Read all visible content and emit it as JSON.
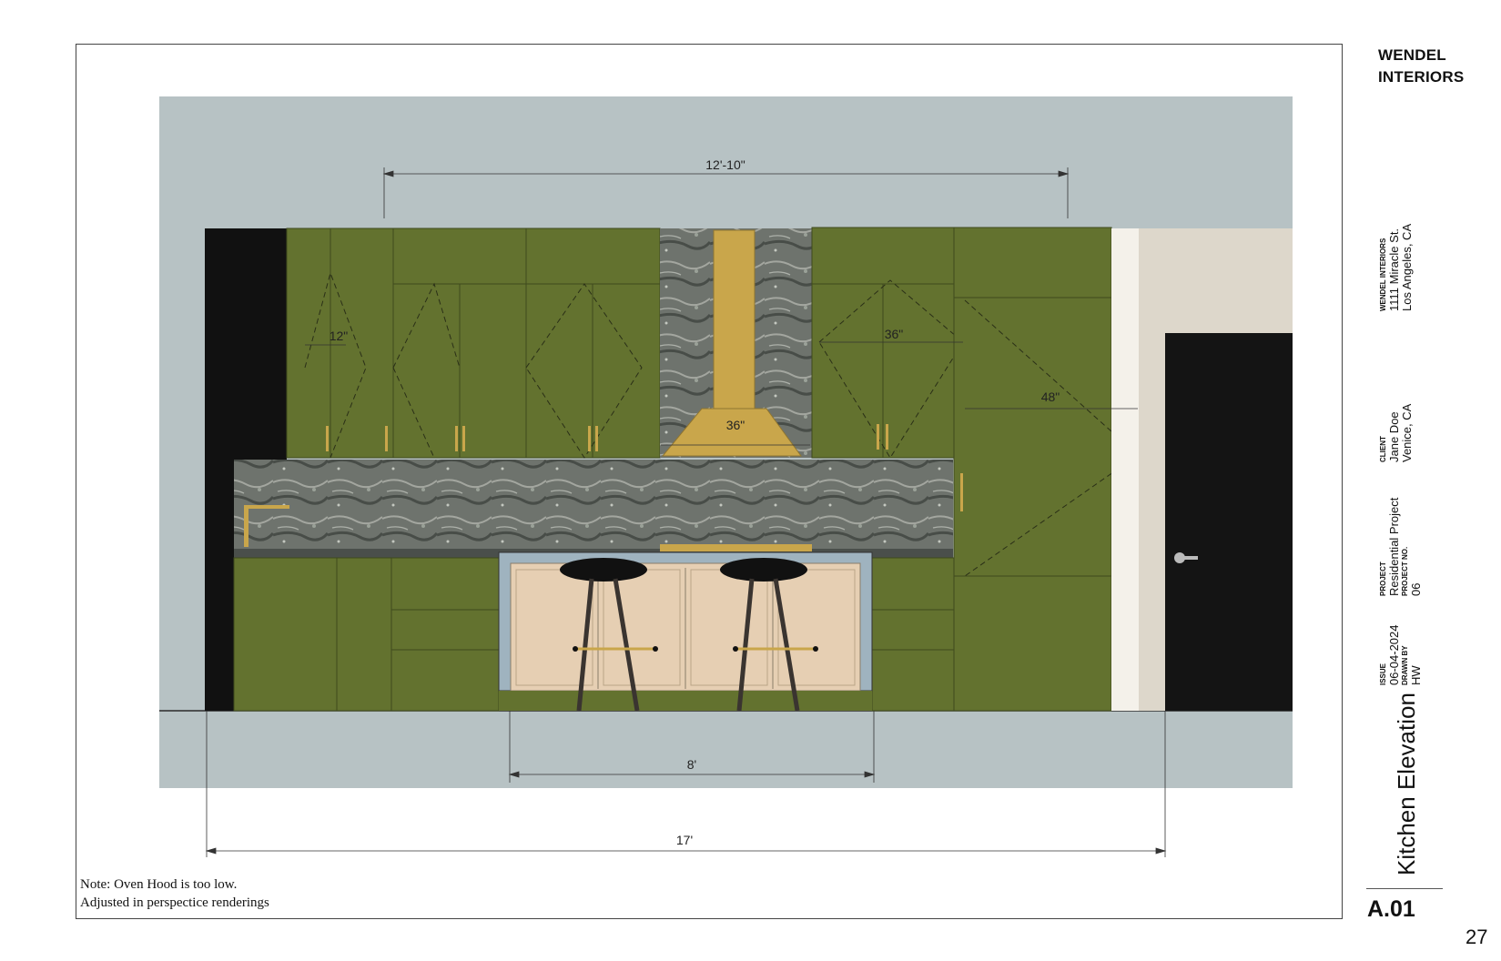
{
  "title_block": {
    "firm_name_line1": "WENDEL",
    "firm_name_line2": "INTERIORS",
    "firm_label": "WENDEL INTERIORS",
    "firm_address_line1": "1111 Miracle St.",
    "firm_address_line2": "Los Angeles, CA",
    "client_label": "CLIENT",
    "client_name": "Jane Doe",
    "client_location": "Venice, CA",
    "project_label": "PROJECT",
    "project_name": "Residential Project",
    "project_no_label": "PROJECT NO.",
    "project_no": "06",
    "issue_label": "ISSUE",
    "issue_date": "06-04-2024",
    "drawn_by_label": "DRAWN BY",
    "drawn_by": "HW",
    "sheet_title": "Kitchen Elevation",
    "sheet_number": "A.01"
  },
  "page_number": "27",
  "note": {
    "line1": "Note: Oven Hood is too low.",
    "line2": "Adjusted in perspectice renderings"
  },
  "dimensions": {
    "upper_overall": "12'-10\"",
    "upper_cabinet_left": "12\"",
    "upper_cabinet_right": "36\"",
    "hood_width": "36\"",
    "pantry_door": "48\"",
    "island": "8'",
    "overall": "17'"
  },
  "colors": {
    "wall": "#b7c2c4",
    "cabinet_green": "#63722f",
    "hood_brass": "#c9a64b",
    "stone": "#6f746e",
    "island_panel": "#e6cfb3",
    "door": "#141414",
    "wall_panel": "#ddd7cb"
  }
}
